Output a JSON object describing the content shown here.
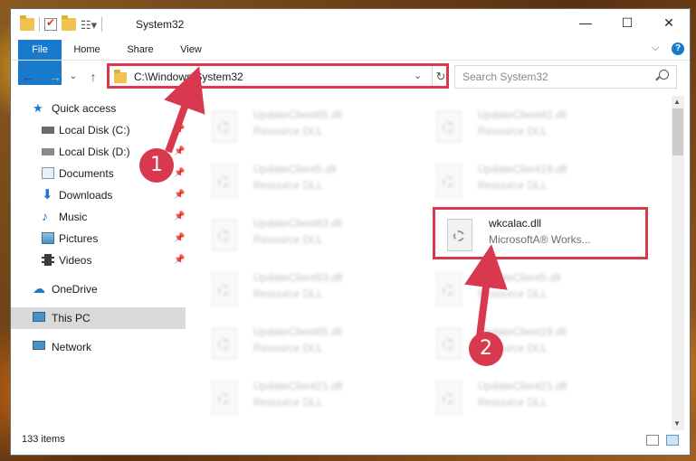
{
  "window": {
    "title": "System32",
    "controls": {
      "minimize": "—",
      "maximize": "☐",
      "close": "✕"
    }
  },
  "ribbon": {
    "tabs": [
      "File",
      "Home",
      "Share",
      "View"
    ],
    "help": "?",
    "chevron": "⌵"
  },
  "nav": {
    "back": "←",
    "forward": "→",
    "recent": "⌄",
    "up": "↑"
  },
  "address": {
    "path": "C:\\Windows\\System32",
    "dropdown": "⌄",
    "refresh": "↻"
  },
  "search": {
    "placeholder": "Search System32"
  },
  "sidebar": {
    "items": [
      {
        "label": "Quick access",
        "icon": "star-icon",
        "pinned": false
      },
      {
        "label": "Local Disk (C:)",
        "icon": "drive-icon",
        "pinned": true
      },
      {
        "label": "Local Disk (D:)",
        "icon": "drive-icon",
        "pinned": true
      },
      {
        "label": "Documents",
        "icon": "documents-icon",
        "pinned": true
      },
      {
        "label": "Downloads",
        "icon": "download-icon",
        "pinned": true
      },
      {
        "label": "Music",
        "icon": "music-icon",
        "pinned": true
      },
      {
        "label": "Pictures",
        "icon": "pictures-icon",
        "pinned": true
      },
      {
        "label": "Videos",
        "icon": "videos-icon",
        "pinned": true
      },
      {
        "label": "OneDrive",
        "icon": "cloud-icon",
        "pinned": false
      },
      {
        "label": "This PC",
        "icon": "computer-icon",
        "pinned": false,
        "selected": true
      },
      {
        "label": "Network",
        "icon": "network-icon",
        "pinned": false
      }
    ]
  },
  "files": {
    "left": [
      {
        "name": "UpdateClient65.dll",
        "type": "Resource DLL"
      },
      {
        "name": "UpdateClient5.dll",
        "type": "Resource DLL"
      },
      {
        "name": "UpdateClient63.dll",
        "type": "Resource DLL"
      },
      {
        "name": "UpdateClient63.dll",
        "type": "Resource DLL"
      },
      {
        "name": "UpdateClient65.dll",
        "type": "Resource DLL"
      },
      {
        "name": "UpdateClient21.dll",
        "type": "Resource DLL"
      }
    ],
    "right": [
      {
        "name": "UpdateClient42.dll",
        "type": "Resource DLL"
      },
      {
        "name": "UpdateClient19.dll",
        "type": "Resource DLL"
      },
      {
        "name": "wkcalac.dll",
        "type": "MicrosoftA® Works..."
      },
      {
        "name": "UpdateClient5.dll",
        "type": "Resource DLL"
      },
      {
        "name": "UpdateClient19.dll",
        "type": "Resource DLL"
      },
      {
        "name": "UpdateClient21.dll",
        "type": "Resource DLL"
      }
    ]
  },
  "status": {
    "items": "133 items"
  },
  "annotations": {
    "step1": "1",
    "step2": "2",
    "color": "#d9394f"
  }
}
